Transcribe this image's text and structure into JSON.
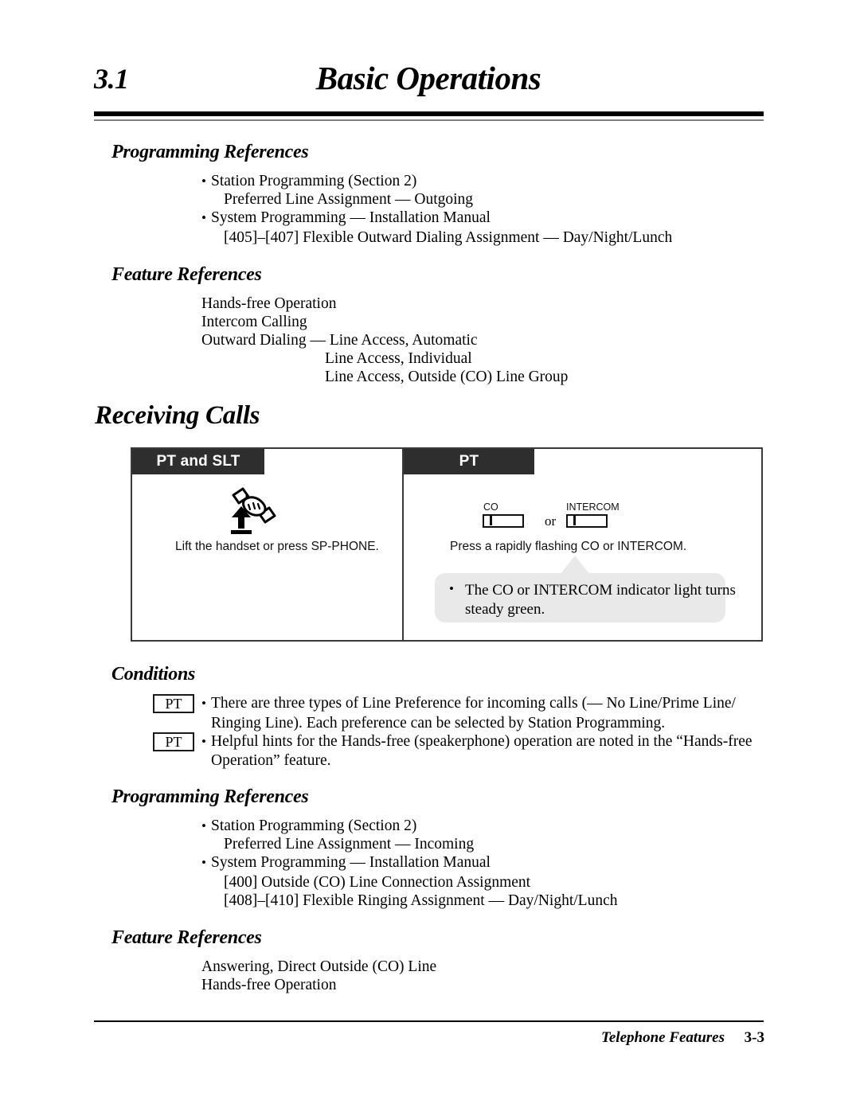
{
  "header": {
    "chapter_number": "3.1",
    "chapter_title": "Basic Operations"
  },
  "section1": {
    "heading": "Programming References",
    "lines": [
      "Station Programming (Section 2)",
      "Preferred Line Assignment — Outgoing",
      "System Programming — Installation Manual",
      "[405]–[407]  Flexible Outward Dialing Assignment — Day/Night/Lunch"
    ]
  },
  "section2": {
    "heading": "Feature References",
    "lines": [
      "Hands-free Operation",
      "Intercom Calling",
      "Outward Dialing — Line Access, Automatic",
      "Line Access, Individual",
      "Line Access, Outside (CO) Line Group"
    ]
  },
  "receiving_calls": {
    "heading": "Receiving Calls",
    "left_panel": {
      "tab_label": "PT and SLT",
      "icon_name": "lift-handset-icon",
      "caption": "Lift the handset or press SP-PHONE."
    },
    "right_panel": {
      "tab_label": "PT",
      "co_label": "CO",
      "intercom_label": "INTERCOM",
      "or_label": "or",
      "caption": "Press a rapidly flashing CO or INTERCOM.",
      "note_bullet": "•",
      "note_line1": "The CO or INTERCOM indicator light turns",
      "note_line2": "steady green."
    }
  },
  "conditions": {
    "heading": "Conditions",
    "items": [
      {
        "tag": "PT",
        "line1": "There are three types of Line Preference for incoming calls (— No Line/Prime Line/",
        "line2": "Ringing Line). Each preference can be selected by Station Programming."
      },
      {
        "tag": "PT",
        "line1": "Helpful hints for the Hands-free (speakerphone) operation are noted in the “Hands-free",
        "line2": "Operation” feature."
      }
    ]
  },
  "section3": {
    "heading": "Programming References",
    "lines": [
      "Station Programming (Section 2)",
      "Preferred Line Assignment — Incoming",
      "System Programming — Installation Manual",
      "[400]  Outside (CO) Line Connection Assignment",
      "[408]–[410]  Flexible Ringing Assignment — Day/Night/Lunch"
    ]
  },
  "section4": {
    "heading": "Feature References",
    "lines": [
      "Answering, Direct Outside (CO) Line",
      "Hands-free Operation"
    ]
  },
  "footer": {
    "title": "Telephone Features",
    "page_number": "3-3"
  },
  "colors": {
    "tab_background": "#2e2e2e",
    "bubble_background": "#e9e9e9",
    "rule": "#000000"
  }
}
